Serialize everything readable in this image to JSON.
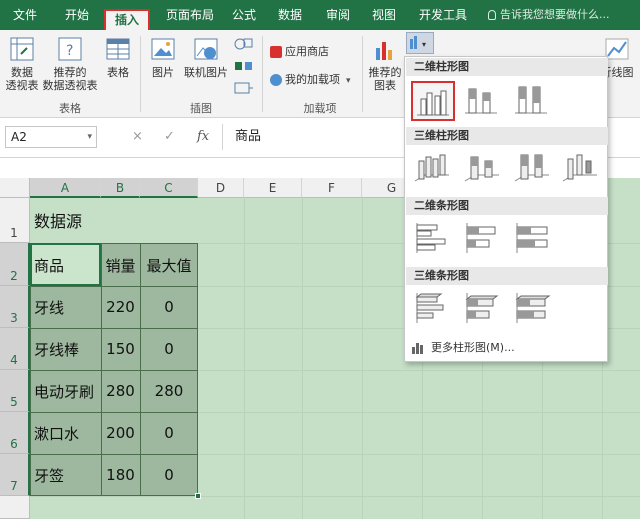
{
  "tabs": [
    "文件",
    "开始",
    "插入",
    "页面布局",
    "公式",
    "数据",
    "审阅",
    "视图",
    "开发工具"
  ],
  "active_tab": "插入",
  "tellme": "告诉我您想要做什么...",
  "ribbon": {
    "pivot": "数据\n透视表",
    "rec_pivot": "推荐的\n数据透视表",
    "table": "表格",
    "group_tables": "表格",
    "picture": "图片",
    "online_picture": "联机图片",
    "group_illustrations": "插图",
    "app_store": "应用商店",
    "my_addins": "我的加载项",
    "group_addins": "加载项",
    "rec_charts": "推荐的\n图表",
    "line_chart": "折线图"
  },
  "formula_bar": {
    "name_box": "A2",
    "cancel": "×",
    "enter": "✓",
    "fx": "fx",
    "content": "商品"
  },
  "columns": [
    "A",
    "B",
    "C",
    "D",
    "E",
    "F",
    "G"
  ],
  "rows": [
    "1",
    "2",
    "3",
    "4",
    "5",
    "6",
    "7"
  ],
  "sheet": {
    "title": "数据源",
    "headers": [
      "商品",
      "销量",
      "最大值"
    ],
    "data": [
      [
        "牙线",
        "220",
        "0"
      ],
      [
        "牙线棒",
        "150",
        "0"
      ],
      [
        "电动牙刷",
        "280",
        "280"
      ],
      [
        "漱口水",
        "200",
        "0"
      ],
      [
        "牙签",
        "180",
        "0"
      ]
    ]
  },
  "dropdown": {
    "sections": [
      "二维柱形图",
      "三维柱形图",
      "二维条形图",
      "三维条形图"
    ],
    "more": "更多柱形图(M)..."
  },
  "colors": {
    "excel_green": "#217346",
    "highlight_red": "#d8302f",
    "table_fill": "#9eb89f",
    "sheet_bg": "#c6e0c8"
  }
}
